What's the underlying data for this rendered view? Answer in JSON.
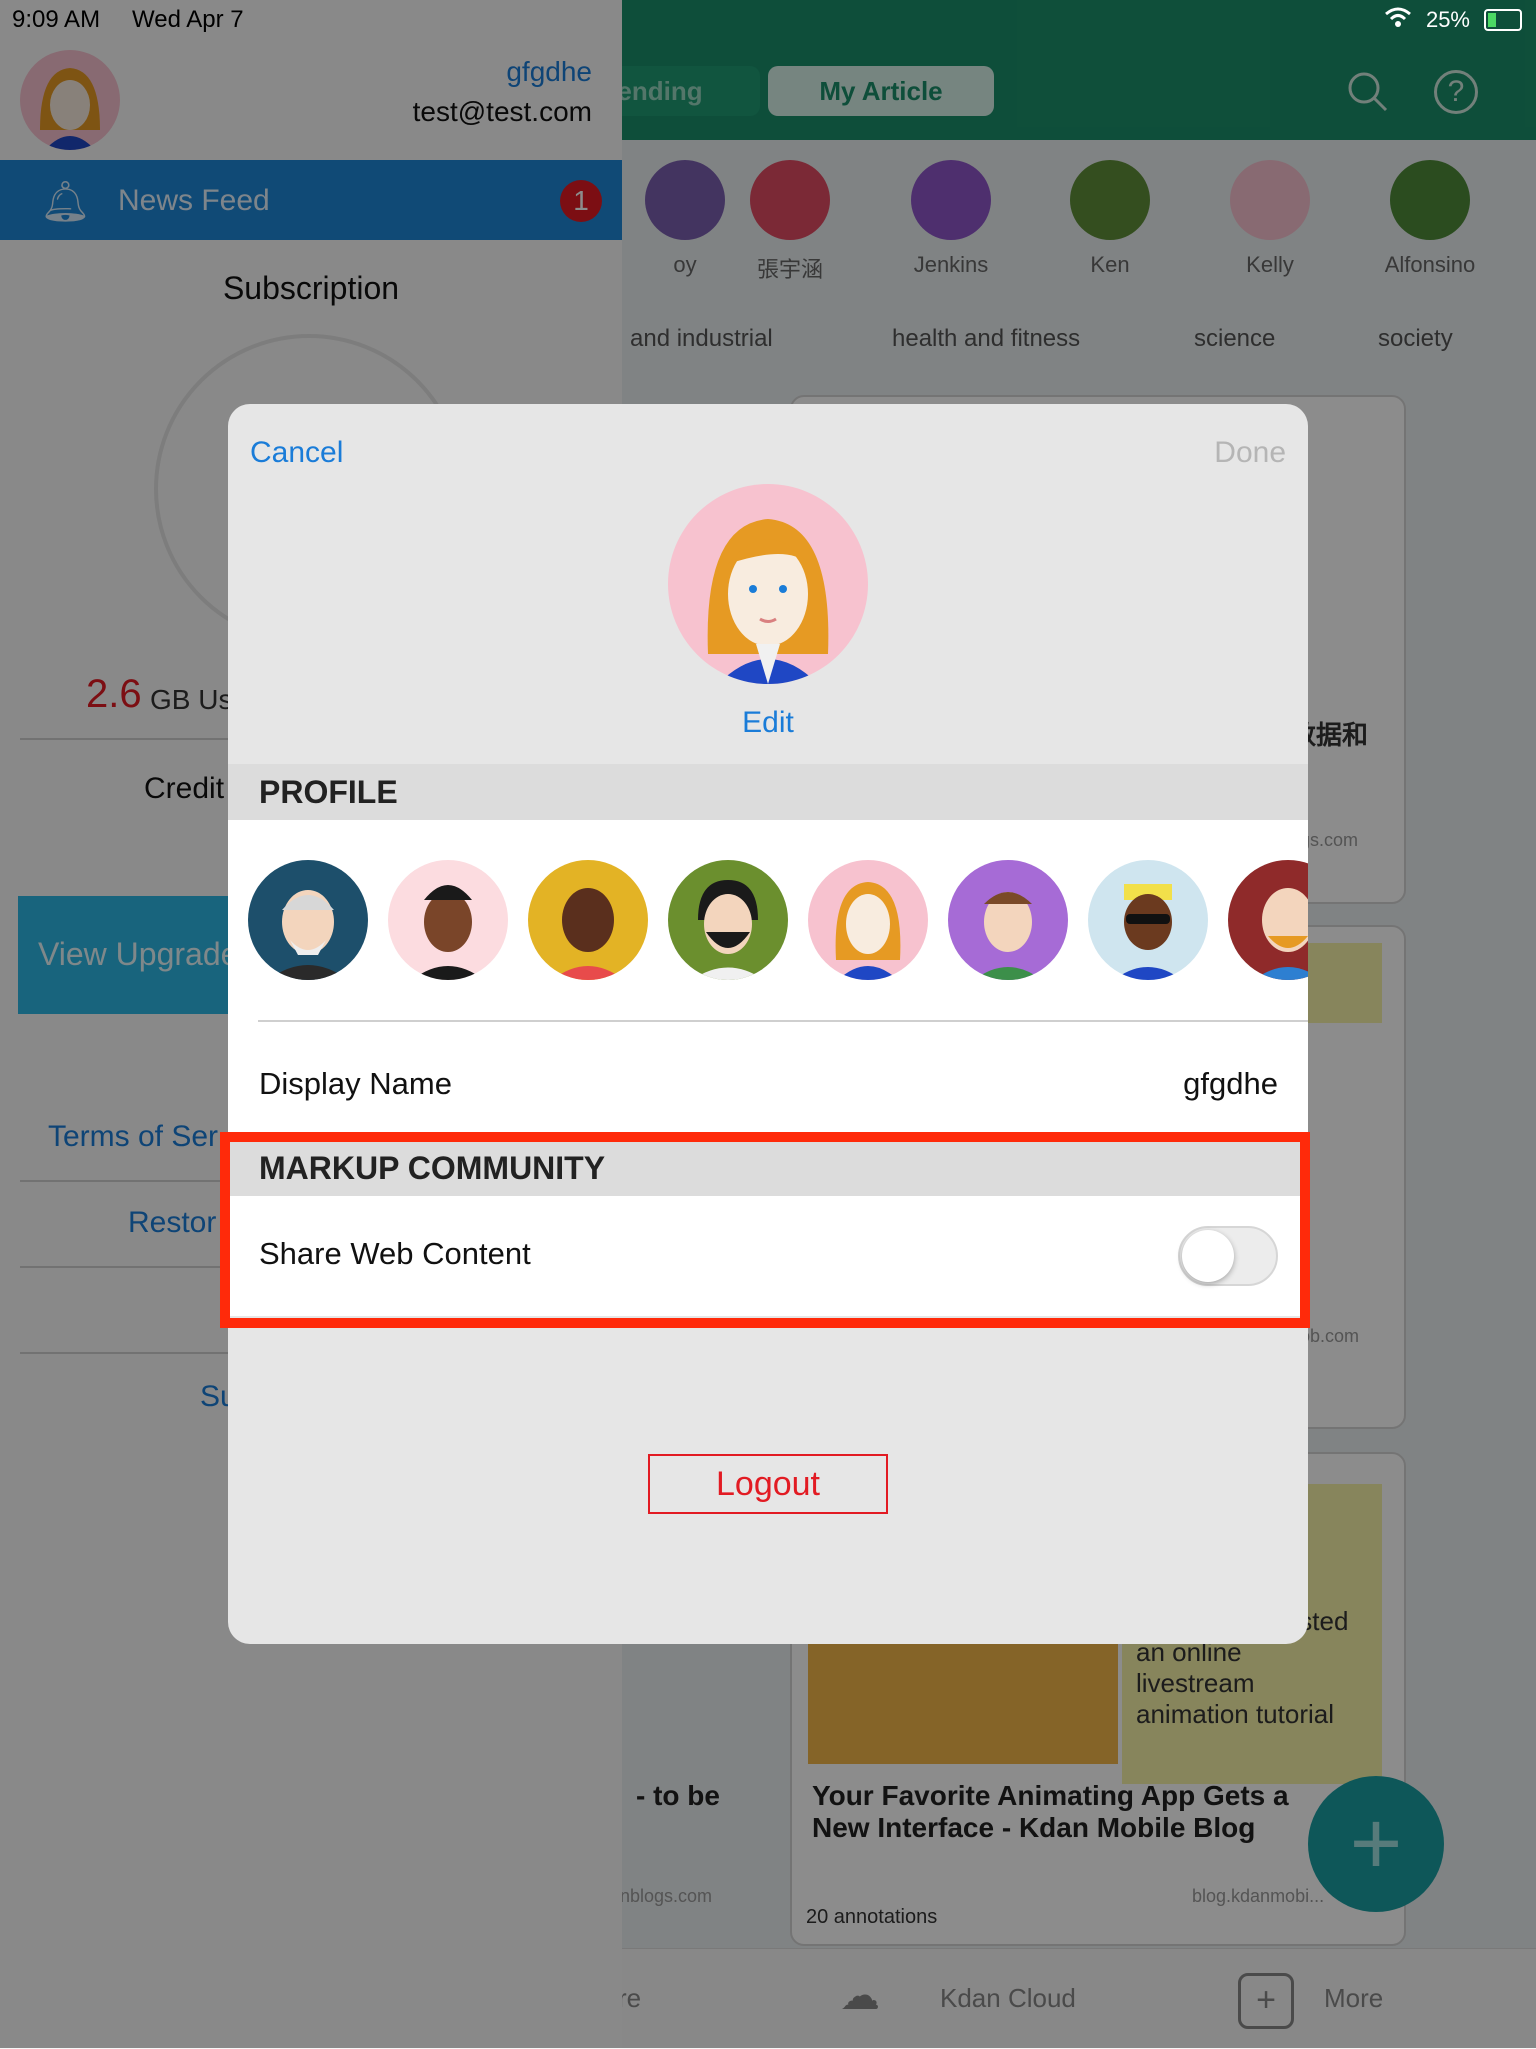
{
  "status_bar": {
    "time": "9:09 AM",
    "date": "Wed Apr 7",
    "battery": "25%"
  },
  "background": {
    "tabs": [
      "ending",
      "My Article"
    ],
    "users": [
      "oy",
      "張宇涵",
      "Jenkins",
      "Ken",
      "Kelly",
      "Alfonsino"
    ],
    "categories": [
      "and industrial",
      "health and fitness",
      "science",
      "society"
    ],
    "card_snippets": {
      "chinese_text": "数据和",
      "domain1": "gs.com",
      "domain2": "ob.com",
      "partial_text": "issed\nyou\n\nsk\nrecently co-hosted\nan online\nlivestream\nanimation tutorial",
      "to_be": "- to be",
      "domain3": "nblogs.com",
      "article_title": "Your Favorite Animating App Gets a New Interface - Kdan Mobile Blog",
      "domain4": "blog.kdanmobi...",
      "annotations": "20 annotations"
    },
    "tabbar": [
      "re",
      "Kdan Cloud",
      "More"
    ]
  },
  "side_panel": {
    "user_name": "gfgdhe",
    "email": "test@test.com",
    "news_feed_label": "News Feed",
    "news_feed_badge": "1",
    "subscription_title": "Subscription",
    "storage_value": "2.6",
    "storage_text": "GB Us",
    "credit_text": "Credit",
    "view_upgrade": "View Upgrade",
    "terms": "Terms of Ser",
    "restore": "Restor",
    "support": "Su"
  },
  "modal": {
    "cancel_label": "Cancel",
    "done_label": "Done",
    "edit_label": "Edit",
    "profile_header": "PROFILE",
    "display_name_label": "Display Name",
    "display_name_value": "gfgdhe",
    "community_header": "MARKUP COMMUNITY",
    "share_web_label": "Share Web Content",
    "share_web_enabled": false,
    "logout_label": "Logout"
  },
  "colors": {
    "accent_blue": "#1a7cd8",
    "header_green": "#1b8f6a",
    "highlight_red": "#ff2a0a",
    "logout_red": "#e21b23"
  }
}
